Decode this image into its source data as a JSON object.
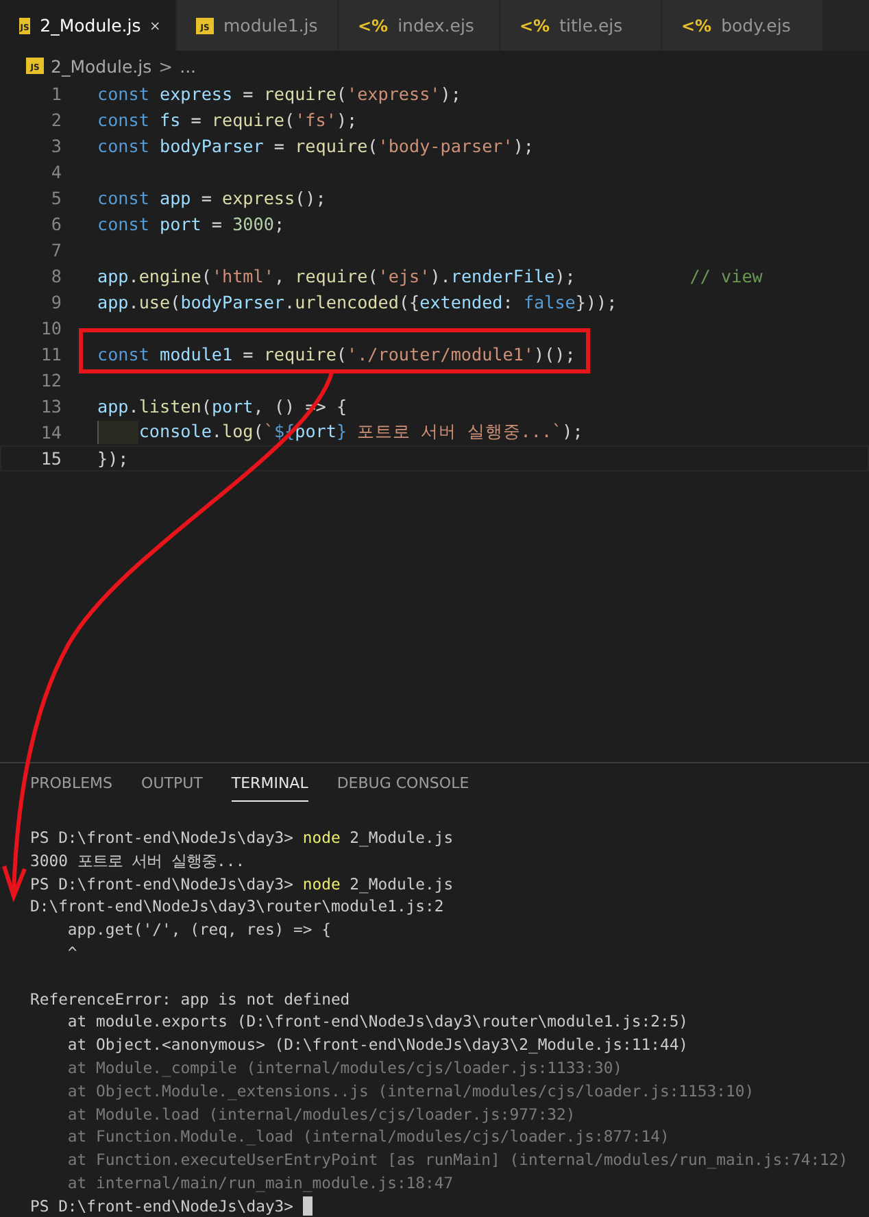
{
  "tabs": [
    {
      "label": "2_Module.js",
      "kind": "js",
      "icon_text": "JS",
      "selected": true
    },
    {
      "label": "module1.js",
      "kind": "js",
      "icon_text": "JS",
      "selected": false
    },
    {
      "label": "index.ejs",
      "kind": "ejs",
      "icon_text": "<%",
      "selected": false
    },
    {
      "label": "title.ejs",
      "kind": "ejs",
      "icon_text": "<%",
      "selected": false
    },
    {
      "label": "body.ejs",
      "kind": "ejs",
      "icon_text": "<%",
      "selected": false
    }
  ],
  "breadcrumb": {
    "icon_text": "JS",
    "file": "2_Module.js",
    "separator": ">",
    "rest": "..."
  },
  "editor": {
    "lines": [
      {
        "number": "1",
        "current": false,
        "tokens": [
          {
            "t": "const ",
            "kind": "kw"
          },
          {
            "t": "express",
            "kind": "var"
          },
          {
            "t": " = ",
            "kind": "plain"
          },
          {
            "t": "require",
            "kind": "fn"
          },
          {
            "t": "(",
            "kind": "plain"
          },
          {
            "t": "'express'",
            "kind": "str"
          },
          {
            "t": ");",
            "kind": "plain"
          }
        ]
      },
      {
        "number": "2",
        "current": false,
        "tokens": [
          {
            "t": "const ",
            "kind": "kw"
          },
          {
            "t": "fs",
            "kind": "var"
          },
          {
            "t": " = ",
            "kind": "plain"
          },
          {
            "t": "require",
            "kind": "fn"
          },
          {
            "t": "(",
            "kind": "plain"
          },
          {
            "t": "'fs'",
            "kind": "str"
          },
          {
            "t": ");",
            "kind": "plain"
          }
        ]
      },
      {
        "number": "3",
        "current": false,
        "tokens": [
          {
            "t": "const ",
            "kind": "kw"
          },
          {
            "t": "bodyParser",
            "kind": "var"
          },
          {
            "t": " = ",
            "kind": "plain"
          },
          {
            "t": "require",
            "kind": "fn"
          },
          {
            "t": "(",
            "kind": "plain"
          },
          {
            "t": "'body-parser'",
            "kind": "str"
          },
          {
            "t": ");",
            "kind": "plain"
          }
        ]
      },
      {
        "number": "4",
        "current": false
      },
      {
        "number": "5",
        "current": false,
        "tokens": [
          {
            "t": "const ",
            "kind": "kw"
          },
          {
            "t": "app",
            "kind": "var"
          },
          {
            "t": " = ",
            "kind": "plain"
          },
          {
            "t": "express",
            "kind": "fn"
          },
          {
            "t": "();",
            "kind": "plain"
          }
        ]
      },
      {
        "number": "6",
        "current": false,
        "tokens": [
          {
            "t": "const ",
            "kind": "kw"
          },
          {
            "t": "port",
            "kind": "var"
          },
          {
            "t": " = ",
            "kind": "plain"
          },
          {
            "t": "3000",
            "kind": "num"
          },
          {
            "t": ";",
            "kind": "plain"
          }
        ]
      },
      {
        "number": "7",
        "current": false
      },
      {
        "number": "8",
        "current": false,
        "tokens": [
          {
            "t": "app",
            "kind": "var"
          },
          {
            "t": ".",
            "kind": "plain"
          },
          {
            "t": "engine",
            "kind": "fn"
          },
          {
            "t": "(",
            "kind": "plain"
          },
          {
            "t": "'html'",
            "kind": "str"
          },
          {
            "t": ", ",
            "kind": "plain"
          },
          {
            "t": "require",
            "kind": "fn"
          },
          {
            "t": "(",
            "kind": "plain"
          },
          {
            "t": "'ejs'",
            "kind": "str"
          },
          {
            "t": ").",
            "kind": "plain"
          },
          {
            "t": "renderFile",
            "kind": "var"
          },
          {
            "t": ");           ",
            "kind": "plain"
          },
          {
            "t": "// view",
            "kind": "cmt"
          }
        ]
      },
      {
        "number": "9",
        "current": false,
        "tokens": [
          {
            "t": "app",
            "kind": "var"
          },
          {
            "t": ".",
            "kind": "plain"
          },
          {
            "t": "use",
            "kind": "fn"
          },
          {
            "t": "(",
            "kind": "plain"
          },
          {
            "t": "bodyParser",
            "kind": "var"
          },
          {
            "t": ".",
            "kind": "plain"
          },
          {
            "t": "urlencoded",
            "kind": "fn"
          },
          {
            "t": "({",
            "kind": "plain"
          },
          {
            "t": "extended",
            "kind": "var"
          },
          {
            "t": ": ",
            "kind": "plain"
          },
          {
            "t": "false",
            "kind": "kw"
          },
          {
            "t": "}));",
            "kind": "plain"
          }
        ]
      },
      {
        "number": "10",
        "current": false
      },
      {
        "number": "11",
        "current": false,
        "tokens": [
          {
            "t": "const ",
            "kind": "kw"
          },
          {
            "t": "module1",
            "kind": "var"
          },
          {
            "t": " = ",
            "kind": "plain"
          },
          {
            "t": "require",
            "kind": "fn"
          },
          {
            "t": "(",
            "kind": "plain"
          },
          {
            "t": "'./router/module1'",
            "kind": "str"
          },
          {
            "t": ")();",
            "kind": "plain"
          }
        ]
      },
      {
        "number": "12",
        "current": false
      },
      {
        "number": "13",
        "current": false,
        "tokens": [
          {
            "t": "app",
            "kind": "var"
          },
          {
            "t": ".",
            "kind": "plain"
          },
          {
            "t": "listen",
            "kind": "fn"
          },
          {
            "t": "(",
            "kind": "plain"
          },
          {
            "t": "port",
            "kind": "var"
          },
          {
            "t": ", () => {",
            "kind": "plain"
          }
        ]
      },
      {
        "number": "14",
        "current": false,
        "tokens": [
          {
            "kind": "indent"
          },
          {
            "t": "console",
            "kind": "var"
          },
          {
            "t": ".",
            "kind": "plain"
          },
          {
            "t": "log",
            "kind": "fn"
          },
          {
            "t": "(",
            "kind": "plain"
          },
          {
            "t": "`",
            "kind": "str"
          },
          {
            "t": "${",
            "kind": "kw"
          },
          {
            "t": "port",
            "kind": "var"
          },
          {
            "t": "}",
            "kind": "kw"
          },
          {
            "t": " 포트로 서버 실행중...`",
            "kind": "str"
          },
          {
            "t": ");",
            "kind": "plain"
          }
        ]
      },
      {
        "number": "15",
        "current": true,
        "tokens": [
          {
            "t": "});",
            "kind": "plain"
          }
        ]
      }
    ]
  },
  "panel": {
    "tabs": [
      {
        "label": "PROBLEMS",
        "selected": false
      },
      {
        "label": "OUTPUT",
        "selected": false
      },
      {
        "label": "TERMINAL",
        "selected": true
      },
      {
        "label": "DEBUG CONSOLE",
        "selected": false
      }
    ],
    "terminal": [
      {
        "kind": "prompt",
        "text": "PS D:\\front-end\\NodeJs\\day3> ",
        "command": "node",
        "args": " 2_Module.js"
      },
      {
        "kind": "out",
        "text": "3000 포트로 서버 실행중..."
      },
      {
        "kind": "prompt",
        "text": "PS D:\\front-end\\NodeJs\\day3> ",
        "command": "node",
        "args": " 2_Module.js"
      },
      {
        "kind": "out",
        "text": "D:\\front-end\\NodeJs\\day3\\router\\module1.js:2"
      },
      {
        "kind": "out",
        "text": "    app.get('/', (req, res) => {"
      },
      {
        "kind": "out",
        "text": "    ^"
      },
      {
        "kind": "blank"
      },
      {
        "kind": "out",
        "text": "ReferenceError: app is not defined"
      },
      {
        "kind": "out",
        "text": "    at module.exports (D:\\front-end\\NodeJs\\day3\\router\\module1.js:2:5)"
      },
      {
        "kind": "out",
        "text": "    at Object.<anonymous> (D:\\front-end\\NodeJs\\day3\\2_Module.js:11:44)"
      },
      {
        "kind": "dim",
        "text": "    at Module._compile (internal/modules/cjs/loader.js:1133:30)"
      },
      {
        "kind": "dim",
        "text": "    at Object.Module._extensions..js (internal/modules/cjs/loader.js:1153:10)"
      },
      {
        "kind": "dim",
        "text": "    at Module.load (internal/modules/cjs/loader.js:977:32)"
      },
      {
        "kind": "dim",
        "text": "    at Function.Module._load (internal/modules/cjs/loader.js:877:14)"
      },
      {
        "kind": "dim",
        "text": "    at Function.executeUserEntryPoint [as runMain] (internal/modules/run_main.js:74:12)"
      },
      {
        "kind": "dim",
        "text": "    at internal/main/run_main_module.js:18:47"
      },
      {
        "kind": "cursor",
        "text": "PS D:\\front-end\\NodeJs\\day3> "
      }
    ]
  }
}
